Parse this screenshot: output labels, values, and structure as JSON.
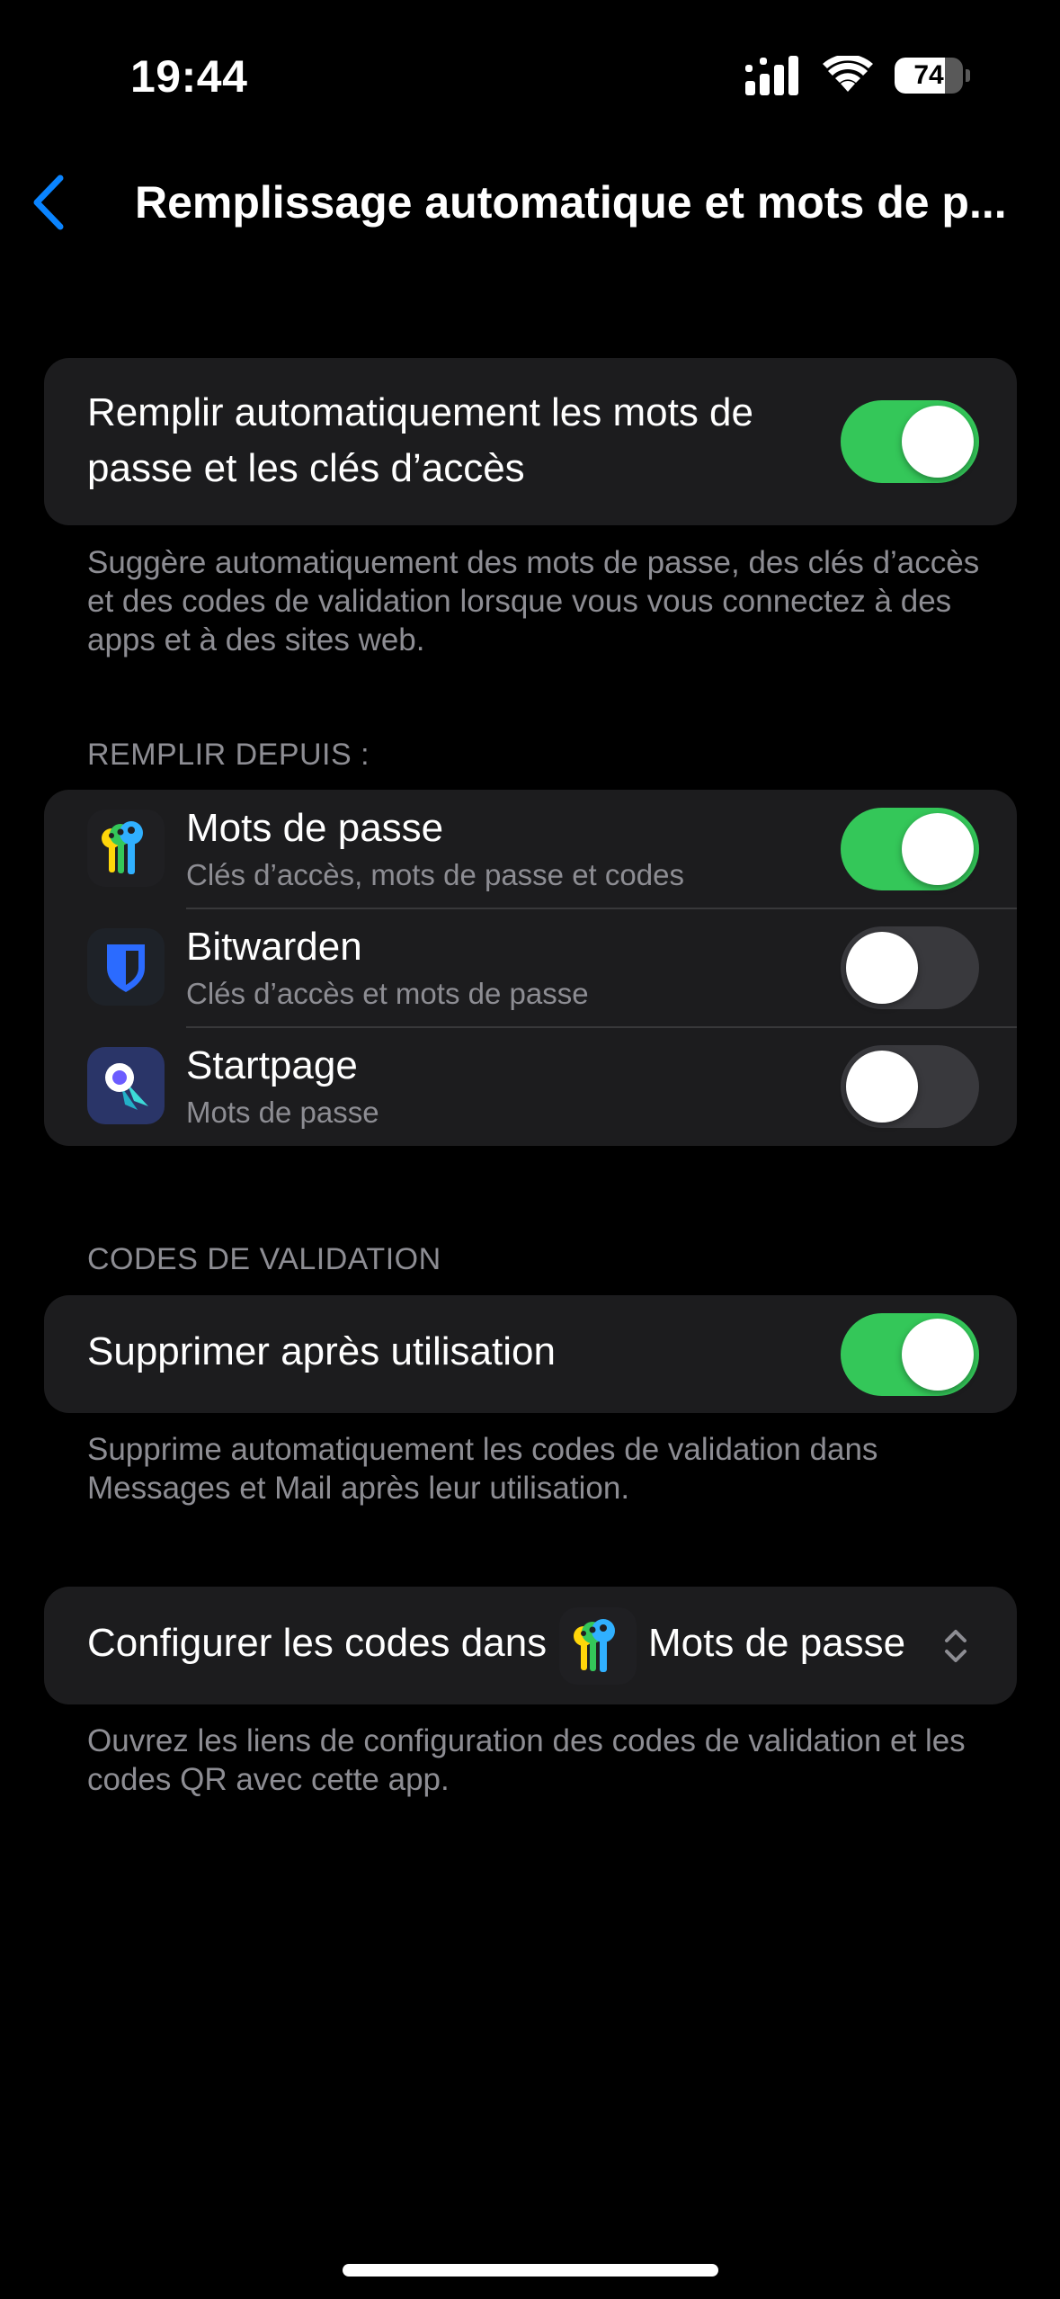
{
  "status_bar": {
    "time": "19:44",
    "battery_level": "74",
    "battery_fraction": 0.74,
    "icons": [
      "signal-icon",
      "wifi-icon",
      "battery-icon"
    ]
  },
  "nav": {
    "back_icon": "chevron-left-icon",
    "title": "Remplissage automatique et mots de p..."
  },
  "autofill": {
    "label": "Remplir automatiquement les mots de passe et les clés d’accès",
    "enabled": true,
    "footer": "Suggère automatiquement des mots de passe, des clés d’accès et des codes de validation lorsque vous vous connectez à des apps et à des sites web."
  },
  "fill_from": {
    "header": "REMPLIR DEPUIS :",
    "items": [
      {
        "name": "Mots de passe",
        "subtitle": "Clés d’accès, mots de passe et codes",
        "icon": "passwords-keys-icon",
        "enabled": true
      },
      {
        "name": "Bitwarden",
        "subtitle": "Clés d’accès et mots de passe",
        "icon": "bitwarden-shield-icon",
        "enabled": false
      },
      {
        "name": "Startpage",
        "subtitle": "Mots de passe",
        "icon": "startpage-rocket-icon",
        "enabled": false
      }
    ]
  },
  "validation_codes": {
    "header": "CODES DE VALIDATION",
    "delete_after_use_label": "Supprimer après utilisation",
    "delete_after_use_enabled": true,
    "footer": "Supprime automatiquement les codes de validation dans Messages et Mail après leur utilisation."
  },
  "setup_codes": {
    "label": "Configurer les codes dans",
    "selected_app": "Mots de passe",
    "selected_app_icon": "passwords-keys-icon",
    "chevron_icon": "chevron-up-down-icon",
    "footer": "Ouvrez les liens de configuration des codes de validation et les codes QR avec cette app."
  },
  "colors": {
    "accent": "#0a84ff",
    "toggle_on": "#34c759",
    "toggle_off": "#39393d",
    "group_bg": "#1c1c1e",
    "secondary_text": "#8d8d93"
  }
}
